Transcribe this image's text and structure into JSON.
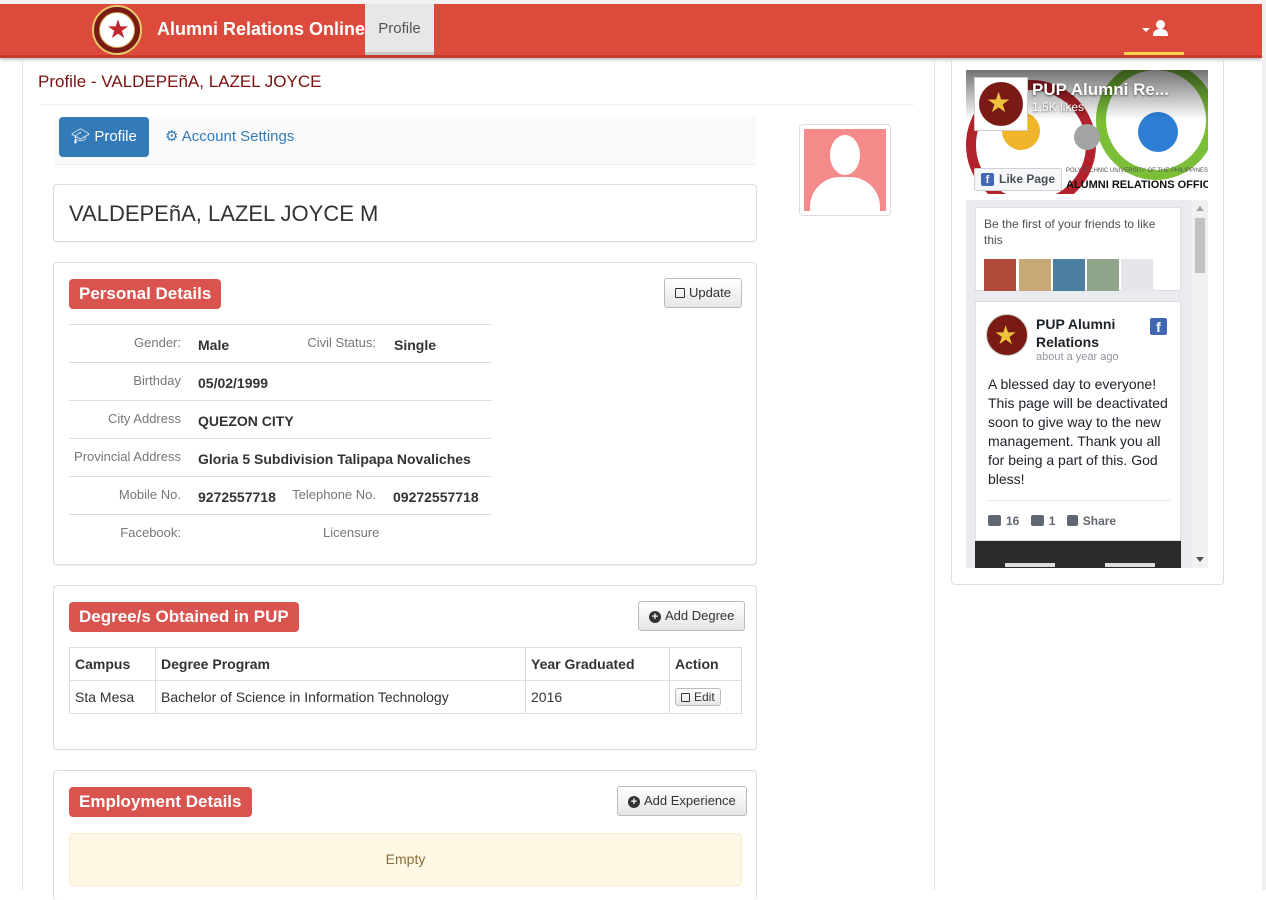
{
  "navbar": {
    "brand": "Alumni Relations Online",
    "profile_tab": "Profile",
    "colors": {
      "bar": "#dc4a3c",
      "active_underline": "#f5d44a"
    }
  },
  "page": {
    "title": "Profile - VALDEPEñA, LAZEL JOYCE"
  },
  "tabs": {
    "profile": "Profile",
    "account_settings": "Account Settings"
  },
  "full_name": "VALDEPEñA, LAZEL JOYCE M",
  "personal": {
    "heading": "Personal Details",
    "update_button": "Update",
    "gender_label": "Gender:",
    "gender": "Male",
    "civil_status_label": "Civil Status:",
    "civil_status": "Single",
    "birthday_label": "Birthday",
    "birthday": "05/02/1999",
    "city_address_label": "City Address",
    "city_address": "QUEZON CITY",
    "provincial_address_label": "Provincial Address",
    "provincial_address": "Gloria 5 Subdivision Talipapa Novaliches",
    "mobile_label": "Mobile No.",
    "mobile": "9272557718",
    "telephone_label": "Telephone No.",
    "telephone": "09272557718",
    "facebook_label": "Facebook:",
    "licensure_label": "Licensure"
  },
  "degrees": {
    "heading": "Degree/s Obtained in PUP",
    "add_button": "Add Degree",
    "columns": [
      "Campus",
      "Degree Program",
      "Year Graduated",
      "Action"
    ],
    "rows": [
      {
        "campus": "Sta Mesa",
        "program": "Bachelor of Science in Information Technology",
        "year": "2016",
        "action": "Edit"
      }
    ]
  },
  "employment": {
    "heading": "Employment Details",
    "add_button": "Add Experience",
    "empty_text": "Empty"
  },
  "facebook": {
    "page_name": "PUP Alumni Re...",
    "likes": "1.5K likes",
    "like_button": "Like Page",
    "cover_caption_small": "POLYTECHNIC UNIVERSITY OF THE PHILIPPINES",
    "cover_caption_big": "ALUMNI RELATIONS OFFICE",
    "friends_text": "Be the first of your friends to like this",
    "post_author": "PUP Alumni Relations",
    "post_time": "about a year ago",
    "post_text": "A blessed day to everyone! This page will be deactivated soon to give way to the new management. Thank you all for being a part of this. God bless!",
    "like_count": "16",
    "comment_count": "1",
    "share_label": "Share"
  }
}
